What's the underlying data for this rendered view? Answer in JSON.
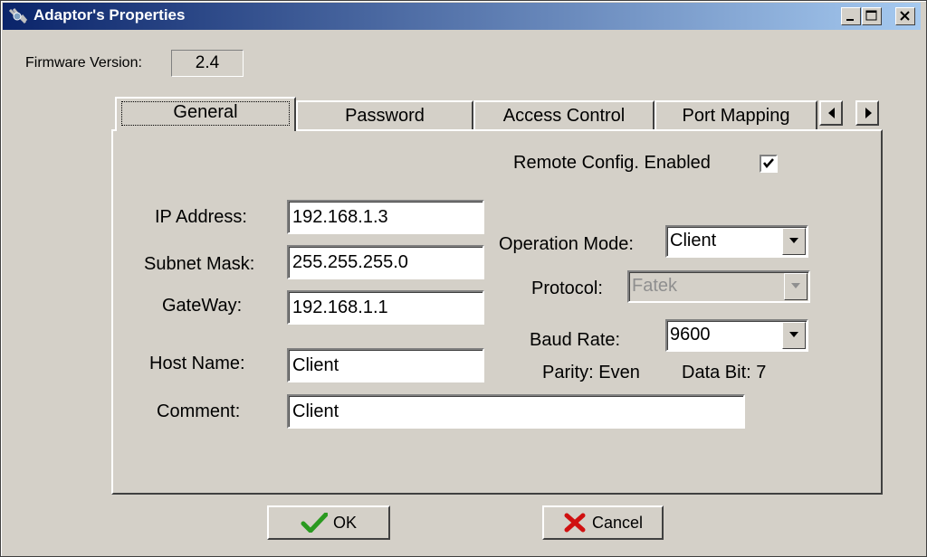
{
  "window": {
    "title": "Adaptor's Properties"
  },
  "firmware": {
    "label": "Firmware Version:",
    "value": "2.4"
  },
  "tabs": [
    {
      "label": "General"
    },
    {
      "label": "Password"
    },
    {
      "label": "Access Control"
    },
    {
      "label": "Port Mapping"
    }
  ],
  "general": {
    "remote_config_label": "Remote Config. Enabled",
    "remote_config_checked": true,
    "ip_label": "IP Address:",
    "ip_value": "192.168.1.3",
    "subnet_label": "Subnet Mask:",
    "subnet_value": "255.255.255.0",
    "gateway_label": "GateWay:",
    "gateway_value": "192.168.1.1",
    "host_label": "Host Name:",
    "host_value": "Client",
    "comment_label": "Comment:",
    "comment_value": "Client",
    "opmode_label": "Operation Mode:",
    "opmode_value": "Client",
    "protocol_label": "Protocol:",
    "protocol_value": "Fatek",
    "baud_label": "Baud Rate:",
    "baud_value": "9600",
    "parity_text": "Parity: Even",
    "databit_text": "Data Bit: 7"
  },
  "buttons": {
    "ok": "OK",
    "cancel": "Cancel"
  },
  "icons": {
    "app": "network-adapter-icon",
    "ok": "checkmark-icon",
    "cancel": "red-x-icon"
  },
  "colors": {
    "title_start": "#0a246a",
    "title_end": "#a6caf0",
    "face": "#d4d0c8"
  }
}
